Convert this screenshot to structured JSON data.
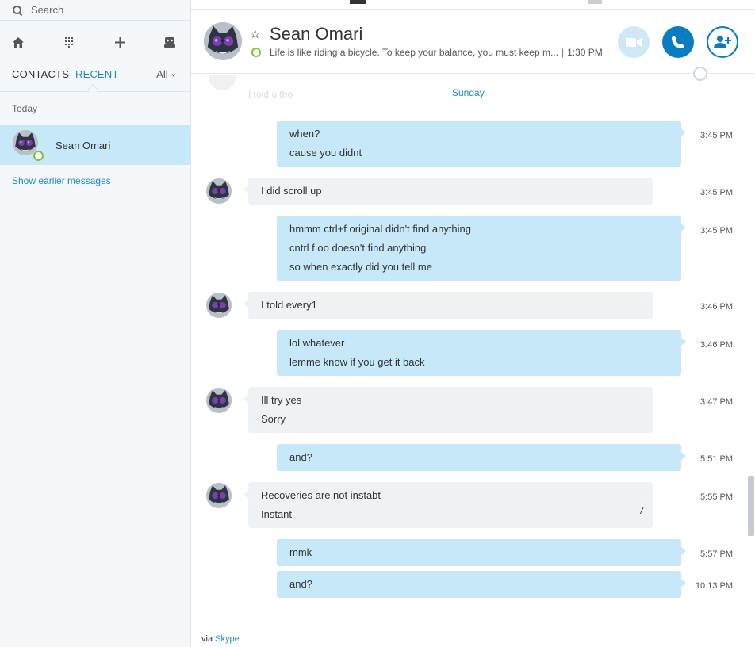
{
  "sidebar": {
    "search_placeholder": "Search",
    "toolbar": [
      "home-icon",
      "dialpad-icon",
      "add-icon",
      "bot-icon"
    ],
    "tabs": [
      {
        "label": "CONTACTS"
      },
      {
        "label": "RECENT",
        "active": true
      }
    ],
    "filter_label": "All",
    "section_label": "Today",
    "contacts": [
      {
        "name": "Sean Omari",
        "presence": "online",
        "selected": true
      }
    ],
    "show_earlier": "Show earlier messages"
  },
  "header": {
    "name": "Sean Omari",
    "mood": "Life is like riding a bicycle. To keep your balance, you must keep m...",
    "time": "1:30 PM",
    "buttons": [
      "video-call",
      "voice-call",
      "add-participant"
    ]
  },
  "conversation": {
    "ghost_text": "I told u tho",
    "day_label": "Sunday",
    "messages": [
      {
        "from": "me",
        "lines": [
          "when?",
          "cause you didnt"
        ],
        "time": "3:45 PM"
      },
      {
        "from": "them",
        "lines": [
          "I did scroll up"
        ],
        "time": "3:45 PM"
      },
      {
        "from": "me",
        "lines": [
          "hmmm ctrl+f original didn't find anything",
          "cntrl f oo doesn't find anything",
          "so when exactly did you tell me"
        ],
        "time": "3:45 PM"
      },
      {
        "from": "them",
        "lines": [
          "I told every1"
        ],
        "time": "3:46 PM"
      },
      {
        "from": "me",
        "lines": [
          "lol whatever",
          "lemme know if you get it back"
        ],
        "time": "3:46 PM"
      },
      {
        "from": "them",
        "lines": [
          "Ill try yes",
          "Sorry"
        ],
        "time": "3:47 PM"
      },
      {
        "from": "me",
        "lines": [
          "and?"
        ],
        "time": "5:51 PM"
      },
      {
        "from": "them",
        "lines": [
          "Recoveries are not instabt",
          "Instant"
        ],
        "time": "5:55 PM",
        "edited": true
      },
      {
        "from": "me",
        "lines": [
          "mmk"
        ],
        "time": "5:57 PM"
      },
      {
        "from": "me",
        "lines": [
          "and?"
        ],
        "time": "10:13 PM"
      }
    ]
  },
  "footer": {
    "via_text": "via",
    "via_link": "Skype"
  },
  "colors": {
    "accent": "#1f8ac9",
    "outgoing_bubble": "#c7e8f8",
    "incoming_bubble": "#eef2f5",
    "online": "#7dc242",
    "call_button": "#0a7cc2"
  }
}
